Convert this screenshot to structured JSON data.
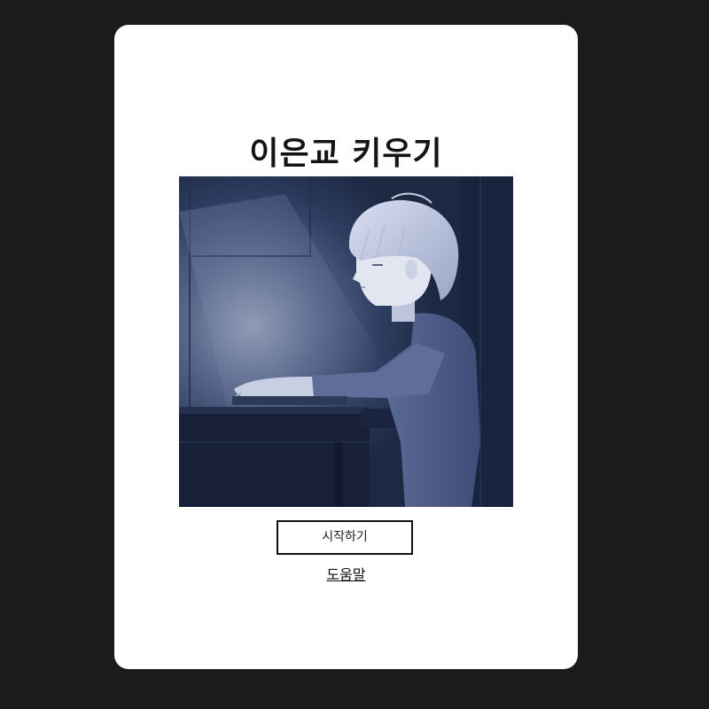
{
  "title": "이은교 키우기",
  "start_button_label": "시작하기",
  "help_link_label": "도움말",
  "colors": {
    "page_background": "#1b1b1b",
    "card_background": "#ffffff",
    "art_base": "#1c2740",
    "art_light": "#c9d3ea"
  },
  "illustration": "boy-at-desk-in-dark-room"
}
